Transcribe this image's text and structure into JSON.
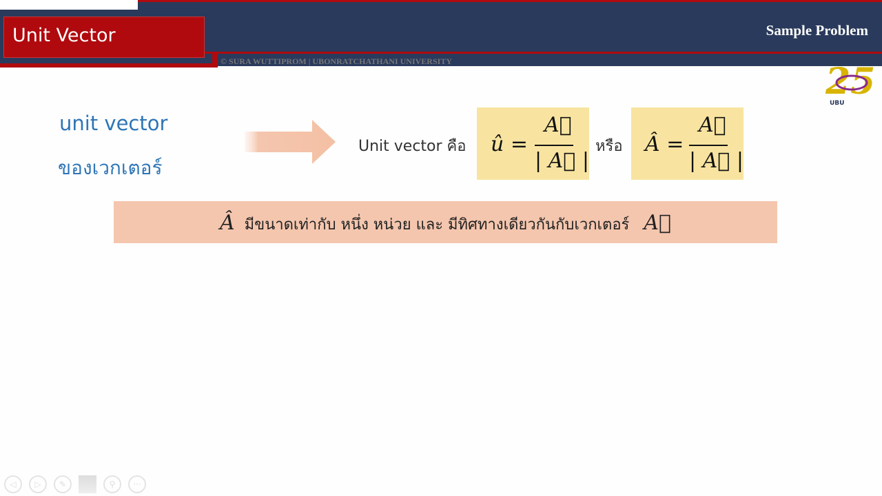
{
  "header": {
    "title": "Unit Vector",
    "section": "Sample Problem",
    "copyright": "© SURA WUTTIPROM | UBONRATCHATHANI UNIVERSITY",
    "logo_text": "25 UBU 25th Anniversary"
  },
  "left": {
    "line1": "unit vector",
    "line2": "ของเวกเตอร์"
  },
  "definition": {
    "label": "Unit vector คือ",
    "formula1_lhs": "û =",
    "numerator": "A⃗",
    "denominator": "| A⃗ |",
    "or": "หรือ",
    "formula2_lhs": "Â ="
  },
  "statement": {
    "symbol1": "Â",
    "text": "มีขนาดเท่ากับ หนึ่ง หน่วย และ มีทิศทางเดียวกันกับเวกเตอร์",
    "symbol2": "A⃗"
  },
  "controls": [
    "previous-icon",
    "next-icon",
    "pen-icon",
    "slides-icon",
    "zoom-icon",
    "more-icon"
  ],
  "colors": {
    "navy": "#2a3a5c",
    "red": "#b00a0e",
    "formula_bg": "#f8e4a0",
    "band_bg": "#f4c6ae",
    "accent": "#2e75b6"
  }
}
